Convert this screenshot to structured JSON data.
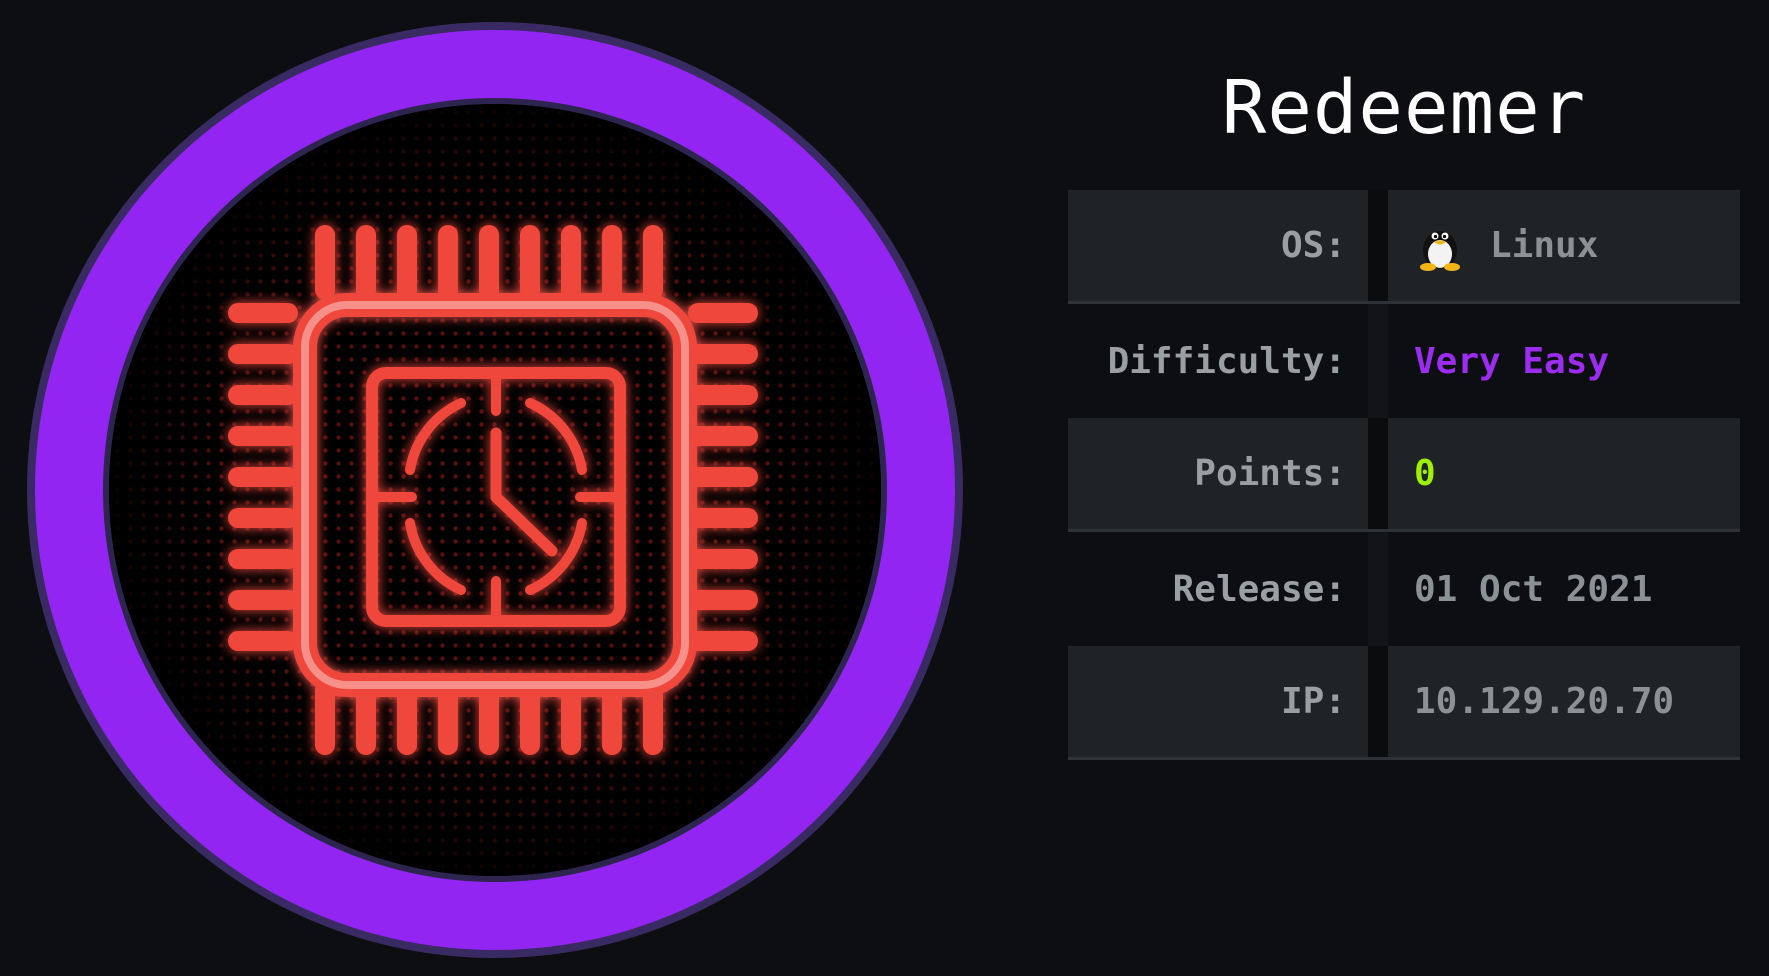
{
  "machine": {
    "name": "Redeemer"
  },
  "details": [
    {
      "key": "os",
      "label": "OS:",
      "value": "Linux",
      "icon": "tux-icon"
    },
    {
      "key": "difficulty",
      "label": "Difficulty:",
      "value": "Very Easy"
    },
    {
      "key": "points",
      "label": "Points:",
      "value": "0"
    },
    {
      "key": "release",
      "label": "Release:",
      "value": "01 Oct 2021"
    },
    {
      "key": "ip",
      "label": "IP:",
      "value": "10.129.20.70"
    }
  ],
  "logo": {
    "icon": "cpu-chip-clock-icon",
    "ring_color": "#9225f2",
    "chip_color": "#f0463e"
  },
  "colors": {
    "background": "#0d0e11",
    "difficulty": "#9b2cf0",
    "points": "#9fef00",
    "label": "#9a9fa4"
  }
}
